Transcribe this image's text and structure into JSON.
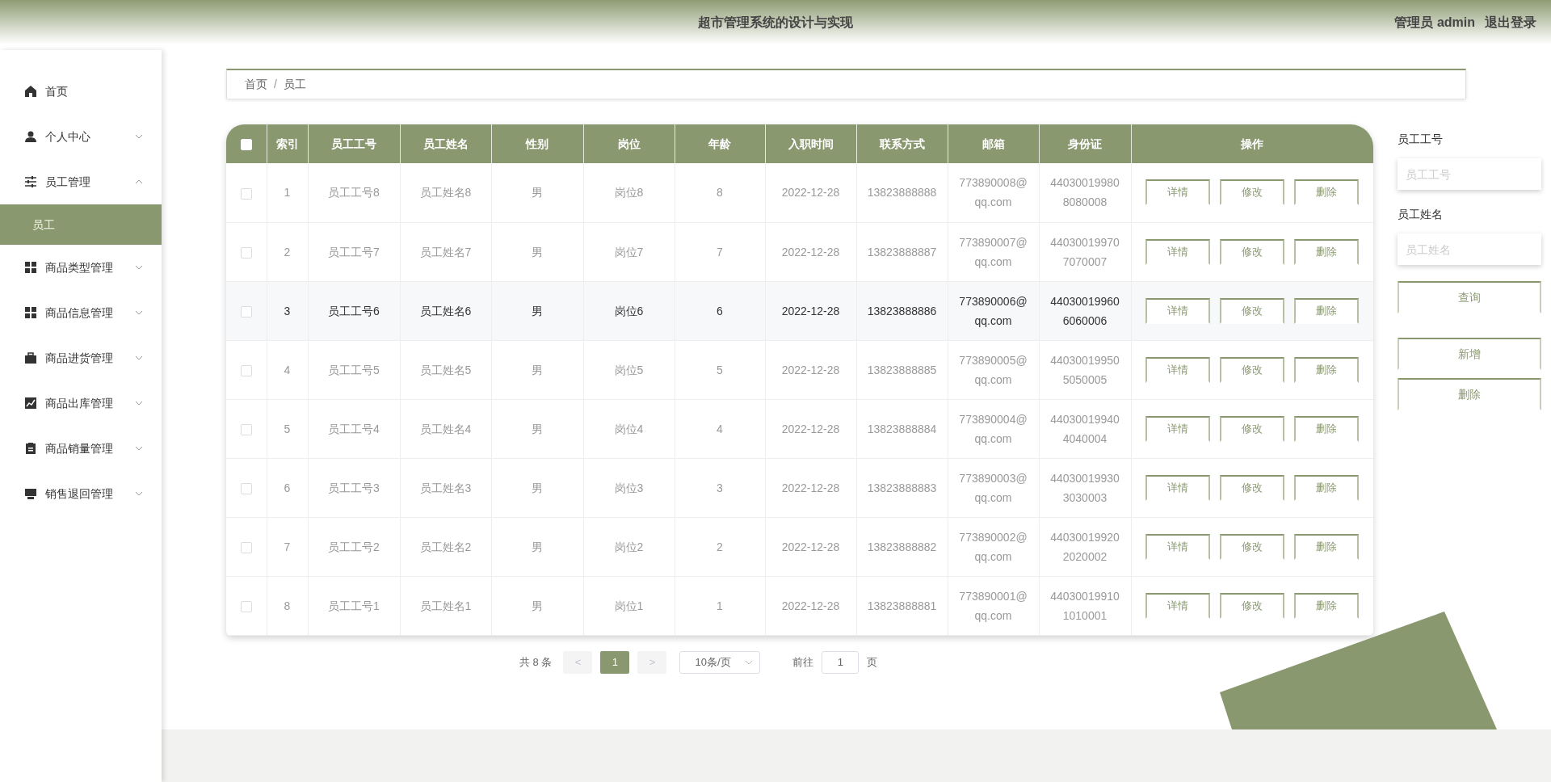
{
  "header": {
    "title": "超市管理系统的设计与实现",
    "user": "管理员 admin",
    "logout": "退出登录"
  },
  "sidebar": {
    "items": [
      {
        "label": "首页",
        "selected": false
      },
      {
        "label": "个人中心",
        "selected": false,
        "expanded": false
      },
      {
        "label": "员工管理",
        "selected": false,
        "expanded": true,
        "children": [
          {
            "label": "员工",
            "selected": true
          }
        ]
      },
      {
        "label": "商品类型管理",
        "selected": false,
        "expanded": false
      },
      {
        "label": "商品信息管理",
        "selected": false,
        "expanded": false
      },
      {
        "label": "商品进货管理",
        "selected": false,
        "expanded": false
      },
      {
        "label": "商品出库管理",
        "selected": false,
        "expanded": false
      },
      {
        "label": "商品销量管理",
        "selected": false,
        "expanded": false
      },
      {
        "label": "销售退回管理",
        "selected": false,
        "expanded": false
      }
    ]
  },
  "breadcrumb": {
    "separator": "/",
    "items": [
      "首页",
      "员工"
    ]
  },
  "table": {
    "all_checked": false,
    "columns": [
      "索引",
      "员工工号",
      "员工姓名",
      "性别",
      "岗位",
      "年龄",
      "入职时间",
      "联系方式",
      "邮箱",
      "身份证",
      "操作"
    ],
    "rows": [
      {
        "checked": false,
        "hovered": false,
        "cells": [
          "1",
          "员工工号8",
          "员工姓名8",
          "男",
          "岗位8",
          "8",
          "2022-12-28",
          "13823888888",
          "773890008@qq.com",
          "440300199808080008"
        ],
        "actions": [
          "详情",
          "修改",
          "删除"
        ]
      },
      {
        "checked": false,
        "hovered": false,
        "cells": [
          "2",
          "员工工号7",
          "员工姓名7",
          "男",
          "岗位7",
          "7",
          "2022-12-28",
          "13823888887",
          "773890007@qq.com",
          "440300199707070007"
        ],
        "actions": [
          "详情",
          "修改",
          "删除"
        ]
      },
      {
        "checked": false,
        "hovered": true,
        "cells": [
          "3",
          "员工工号6",
          "员工姓名6",
          "男",
          "岗位6",
          "6",
          "2022-12-28",
          "13823888886",
          "773890006@qq.com",
          "440300199606060006"
        ],
        "actions": [
          "详情",
          "修改",
          "删除"
        ]
      },
      {
        "checked": false,
        "hovered": false,
        "cells": [
          "4",
          "员工工号5",
          "员工姓名5",
          "男",
          "岗位5",
          "5",
          "2022-12-28",
          "13823888885",
          "773890005@qq.com",
          "440300199505050005"
        ],
        "actions": [
          "详情",
          "修改",
          "删除"
        ]
      },
      {
        "checked": false,
        "hovered": false,
        "cells": [
          "5",
          "员工工号4",
          "员工姓名4",
          "男",
          "岗位4",
          "4",
          "2022-12-28",
          "13823888884",
          "773890004@qq.com",
          "440300199404040004"
        ],
        "actions": [
          "详情",
          "修改",
          "删除"
        ]
      },
      {
        "checked": false,
        "hovered": false,
        "cells": [
          "6",
          "员工工号3",
          "员工姓名3",
          "男",
          "岗位3",
          "3",
          "2022-12-28",
          "13823888883",
          "773890003@qq.com",
          "440300199303030003"
        ],
        "actions": [
          "详情",
          "修改",
          "删除"
        ]
      },
      {
        "checked": false,
        "hovered": false,
        "cells": [
          "7",
          "员工工号2",
          "员工姓名2",
          "男",
          "岗位2",
          "2",
          "2022-12-28",
          "13823888882",
          "773890002@qq.com",
          "440300199202020002"
        ],
        "actions": [
          "详情",
          "修改",
          "删除"
        ]
      },
      {
        "checked": false,
        "hovered": false,
        "cells": [
          "8",
          "员工工号1",
          "员工姓名1",
          "男",
          "岗位1",
          "1",
          "2022-12-28",
          "13823888881",
          "773890001@qq.com",
          "440300199101010001"
        ],
        "actions": [
          "详情",
          "修改",
          "删除"
        ]
      }
    ]
  },
  "pagination": {
    "total": "共 8 条",
    "prev": "<",
    "pages": [
      {
        "label": "1",
        "selected": true
      }
    ],
    "next": ">",
    "page_size": "10条/页",
    "goto_label": "前往",
    "goto_value": "1",
    "goto_suffix": "页"
  },
  "search_panel": {
    "fields": [
      {
        "label": "员工工号",
        "placeholder": "员工工号"
      },
      {
        "label": "员工姓名",
        "placeholder": "员工姓名"
      }
    ],
    "search_button": "查询",
    "buttons": [
      "新增",
      "删除"
    ]
  }
}
